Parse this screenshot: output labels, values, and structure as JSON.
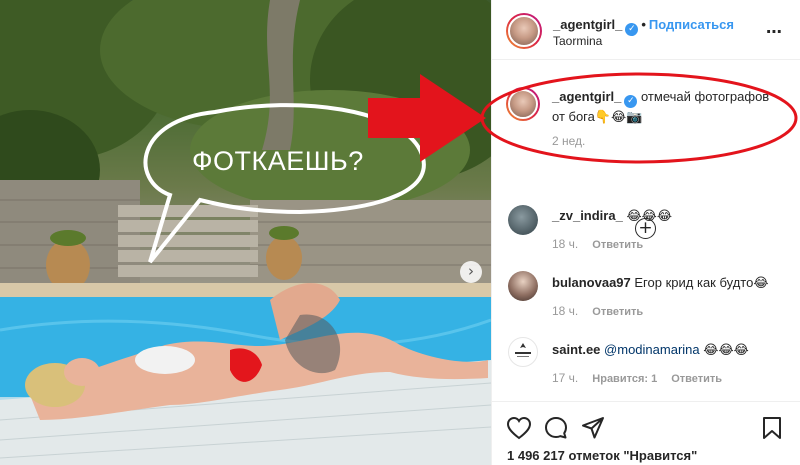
{
  "photo": {
    "speech_bubble_text": "ФОТКАЕШЬ?",
    "next_icon": "chevron-right-icon"
  },
  "header": {
    "username": "_agentgirl_",
    "verified_icon": "verified-badge-icon",
    "dot": "•",
    "follow_label": "Подписаться",
    "location": "Taormina",
    "more_icon": "ellipsis-icon",
    "more_glyph": "⋯"
  },
  "caption": {
    "username": "_agentgirl_",
    "text": "отмечай фотографов от бога",
    "emoji": "👇😂📷",
    "time": "2 нед."
  },
  "load_more": {
    "glyph": "+",
    "icon": "plus-circle-icon"
  },
  "comments": [
    {
      "username": "_zv_indira_",
      "text": "",
      "emoji": "😂😂😂",
      "time": "18 ч.",
      "reply": "Ответить",
      "likes": ""
    },
    {
      "username": "bulanovaa97",
      "text": "Егор крид как будто",
      "emoji": "😂",
      "time": "18 ч.",
      "reply": "Ответить",
      "likes": ""
    },
    {
      "username": "saint.ee",
      "mention": "@modinamarina",
      "text": "",
      "emoji": "😂😂😂",
      "time": "17 ч.",
      "likes": "Нравится: 1",
      "reply": "Ответить"
    }
  ],
  "actions": {
    "like_icon": "heart-icon",
    "comment_icon": "comment-icon",
    "share_icon": "share-icon",
    "save_icon": "bookmark-icon",
    "likes_text": "1 496 217 отметок \"Нравится\""
  },
  "colors": {
    "link_blue": "#3897f0",
    "annotation_red": "#e3141c",
    "muted_gray": "#999999"
  }
}
